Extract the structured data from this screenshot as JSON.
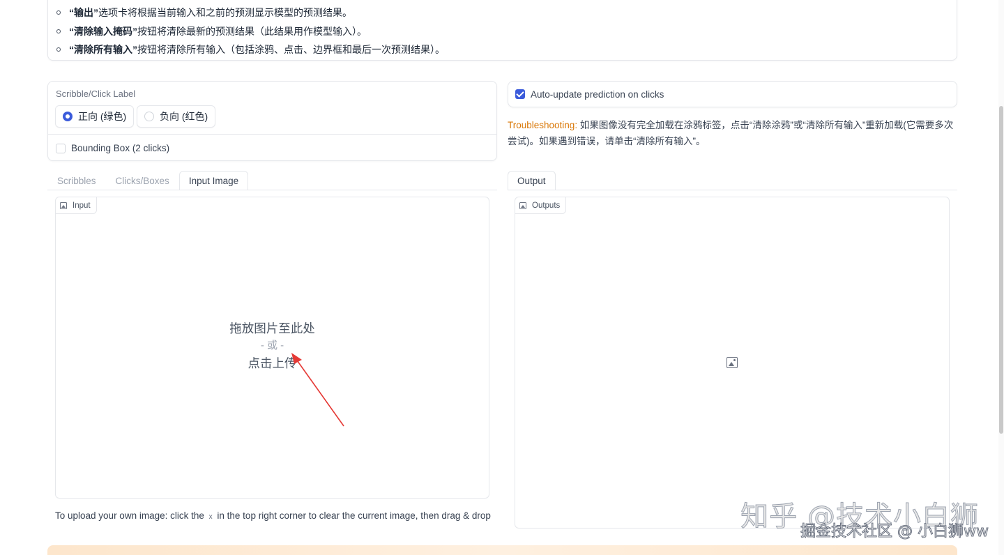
{
  "instructions": [
    {
      "bold": "“输出”",
      "text": " 选项卡将根据当前输入和之前的预测显示模型的预测结果。"
    },
    {
      "bold": "“清除输入掩码”",
      "text": " 按钮将清除最新的预测结果（此结果用作模型输入）。"
    },
    {
      "bold": "“清除所有输入”",
      "text": " 按钮将清除所有输入（包括涂鸦、点击、边界框和最后一次预测结果）。"
    }
  ],
  "label_panel": {
    "title": "Scribble/Click Label",
    "options": [
      "正向 (绿色)",
      "负向 (红色)"
    ],
    "selected": "正向 (绿色)",
    "bbox_checkbox": "Bounding Box (2 clicks)",
    "bbox_checked": false
  },
  "auto_update": {
    "label": "Auto-update prediction on clicks",
    "checked": true
  },
  "troubleshooting": {
    "prefix": "Troubleshooting:",
    "text": " 如果图像没有完全加载在涂鸦标签，点击“清除涂鸦”或“清除所有输入”重新加载(它需要多次尝试)。如果遇到错误，请单击“清除所有输入”。"
  },
  "left_tabs": [
    "Scribbles",
    "Clicks/Boxes",
    "Input Image"
  ],
  "left_active_tab": "Input Image",
  "right_tabs": [
    "Output"
  ],
  "input_pane": {
    "label": "Input",
    "drop_text": "拖放图片至此处",
    "or_text": "- 或 -",
    "click_text": "点击上传"
  },
  "output_pane": {
    "label": "Outputs"
  },
  "hint": {
    "before": "To upload your own image: click the",
    "x": "x",
    "after": "in the top right corner to clear the current image, then drag & drop"
  },
  "watermark": {
    "line1": "知乎 @技术小白狮",
    "line2": "掘金技术社区 @ 小白狮ww"
  },
  "colors": {
    "accent": "#3b5bdb",
    "troubleshooting": "#d97706",
    "annotation_arrow": "#e53935"
  },
  "icons": [
    "image-icon",
    "checkbox-checked-icon",
    "radio-icon"
  ]
}
